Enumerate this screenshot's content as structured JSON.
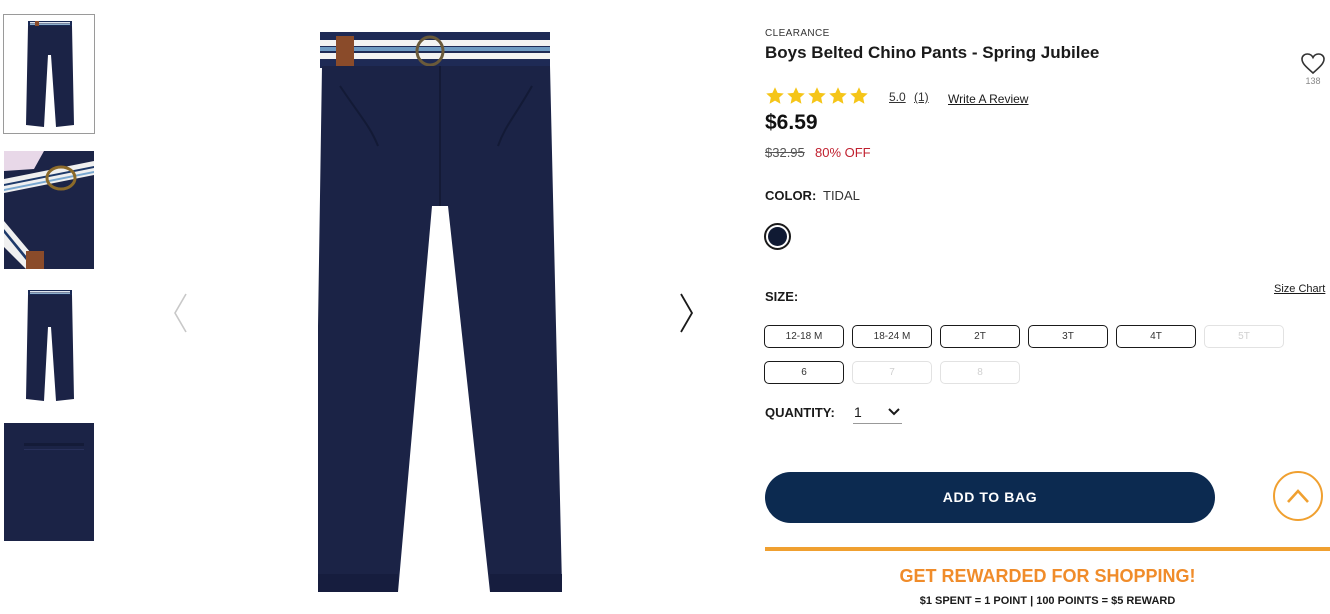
{
  "gallery": {
    "thumbnails": [
      {
        "name": "front-full-view",
        "active": true
      },
      {
        "name": "belt-closeup"
      },
      {
        "name": "back-full-view"
      },
      {
        "name": "pocket-closeup"
      }
    ],
    "prev_icon": "chevron-left",
    "next_icon": "chevron-right"
  },
  "product": {
    "badge": "CLEARANCE",
    "title": "Boys Belted Chino Pants - Spring Jubilee",
    "favorite_count": "138",
    "rating": {
      "stars": 5,
      "value": "5.0",
      "count": "(1)",
      "write_review": "Write A Review"
    },
    "price": "$6.59",
    "original_price": "$32.95",
    "discount": "80% OFF",
    "color": {
      "label": "COLOR:",
      "value": "TIDAL",
      "swatch": "#101a33"
    },
    "size": {
      "label": "SIZE:",
      "chart_link": "Size Chart",
      "options": [
        {
          "label": "12-18 M",
          "available": true
        },
        {
          "label": "18-24 M",
          "available": true
        },
        {
          "label": "2T",
          "available": true
        },
        {
          "label": "3T",
          "available": true
        },
        {
          "label": "4T",
          "available": true
        },
        {
          "label": "5T",
          "available": false
        },
        {
          "label": "6",
          "available": true
        },
        {
          "label": "7",
          "available": false
        },
        {
          "label": "8",
          "available": false
        }
      ]
    },
    "quantity": {
      "label": "QUANTITY:",
      "value": "1"
    },
    "add_to_bag": "ADD TO BAG"
  },
  "rewards": {
    "title": "GET REWARDED FOR SHOPPING!",
    "subtitle": "$1 SPENT = 1 POINT | 100 POINTS = $5 REWARD"
  },
  "colors": {
    "navy": "#0c2a50",
    "accent_orange": "#f0a030",
    "discount_red": "#c0202f",
    "star_yellow": "#f5c518"
  }
}
